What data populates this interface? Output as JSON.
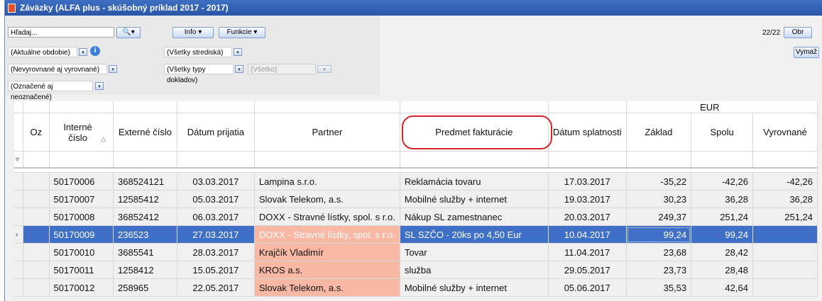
{
  "window": {
    "title": "Záväzky (ALFA plus - skúšobný príklad 2017 - 2017)"
  },
  "toolbar": {
    "search_value": "Hľadaj...",
    "info_label": "Info",
    "funkcie_label": "Funkcie",
    "record_count": "22/22",
    "obr_label": "Obr",
    "vymaz_label": "Vymaž",
    "period_select": "(Aktuálne obdobie)",
    "settle_select": "(Nevyrovnané aj vyrovnané)",
    "mark_select": "(Označené aj neoznačené)",
    "center_select": "(Všetky strediská)",
    "doctype_select": "(Všetky typy dokladov)",
    "doctype_sub": "(Všetko)"
  },
  "grid": {
    "group_header": "EUR",
    "columns": [
      "Oz",
      "Interné číslo",
      "Externé číslo",
      "Dátum prijatia",
      "Partner",
      "Predmet fakturácie",
      "Dátum splatnosti",
      "Základ",
      "Spolu",
      "Vyrovnané"
    ],
    "rows": [
      [
        "",
        "50170006",
        "368524121",
        "03.03.2017",
        "Lampina s.r.o.",
        "Reklamácia tovaru",
        "17.03.2017",
        "-35,22",
        "-42,26",
        "-42,26"
      ],
      [
        "",
        "50170007",
        "12585412",
        "05.03.2017",
        "Slovak Telekom, a.s.",
        "Mobilné služby + internet",
        "19.03.2017",
        "30,23",
        "36,28",
        "36,28"
      ],
      [
        "",
        "50170008",
        "36852412",
        "06.03.2017",
        "DOXX - Stravné lístky, spol. s r.o.",
        "Nákup SL zamestnanec",
        "20.03.2017",
        "249,37",
        "251,24",
        "251,24"
      ],
      [
        "",
        "50170009",
        "236523",
        "27.03.2017",
        "DOXX - Stravné lístky, spol. s r.o.",
        "SL SZČO - 20ks po 4,50 Eur",
        "10.04.2017",
        "99,24",
        "99,24",
        ""
      ],
      [
        "",
        "50170010",
        "3685541",
        "28.03.2017",
        "Krajčík Vladimír",
        "Tovar",
        "11.04.2017",
        "23,68",
        "28,42",
        ""
      ],
      [
        "",
        "50170011",
        "1258412",
        "15.05.2017",
        "KROS a.s.",
        "služba",
        "29.05.2017",
        "23,73",
        "28,48",
        ""
      ],
      [
        "",
        "50170012",
        "258965",
        "22.05.2017",
        "Slovak Telekom, a.s.",
        "Mobilné služby + internet",
        "05.06.2017",
        "35,53",
        "42,64",
        ""
      ]
    ],
    "selected_row": 3,
    "pink_rows": [
      3,
      4,
      5,
      6
    ]
  },
  "colors": {
    "title_bar": "#2a56a8",
    "selection": "#3f6fc6",
    "highlight_pink": "#f8b8a4",
    "annotation_circle": "#d8232a"
  },
  "icons": [
    "search-icon",
    "info-icon",
    "dropdown-arrow-icon",
    "app-icon"
  ]
}
